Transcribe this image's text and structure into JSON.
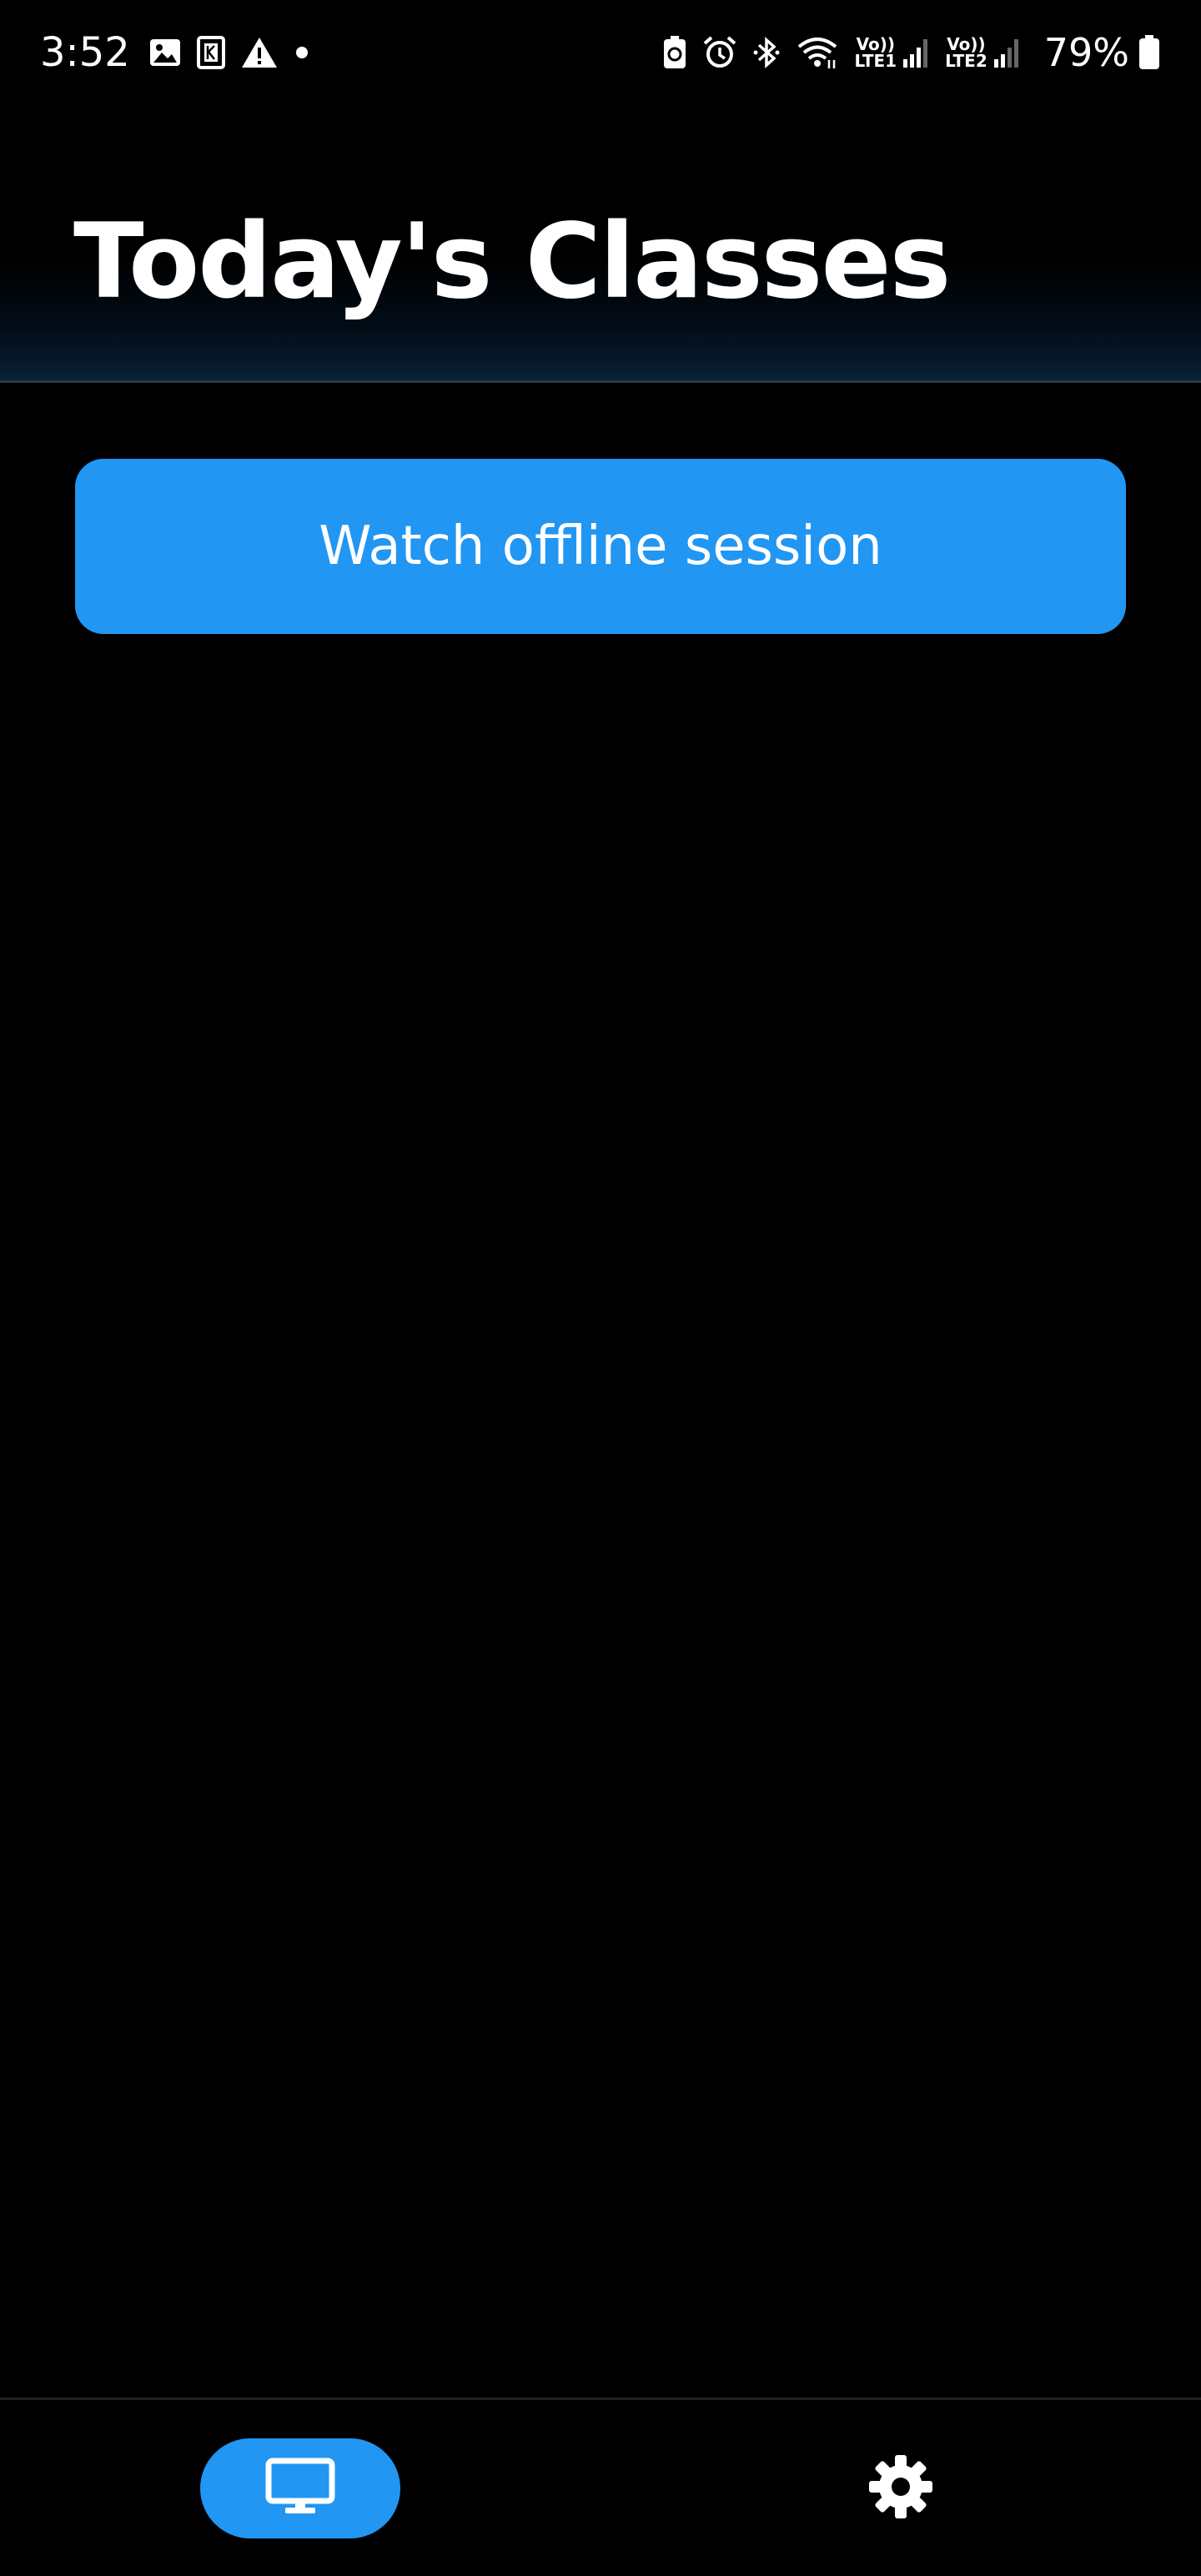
{
  "status_bar": {
    "time": "3:52",
    "left_icons": [
      "gallery-icon",
      "app-k-icon",
      "warning-icon",
      "dot-icon"
    ],
    "right_icons": [
      "battery-saver-icon",
      "alarm-icon",
      "bluetooth-icon",
      "wifi-icon",
      "signal-1-icon",
      "signal-2-icon",
      "battery-icon"
    ],
    "sim1_top": "Vo))",
    "sim1_bottom": "LTE1",
    "sim2_top": "Vo))",
    "sim2_bottom": "LTE2",
    "battery": "79%"
  },
  "header": {
    "title": "Today's Classes"
  },
  "main": {
    "offline_button_label": "Watch offline session"
  },
  "bottom_nav": {
    "items": [
      {
        "icon": "monitor-icon",
        "active": true
      },
      {
        "icon": "gear-icon",
        "active": false
      }
    ]
  },
  "colors": {
    "background": "#000000",
    "accent": "#2196f3",
    "text": "#ffffff"
  }
}
